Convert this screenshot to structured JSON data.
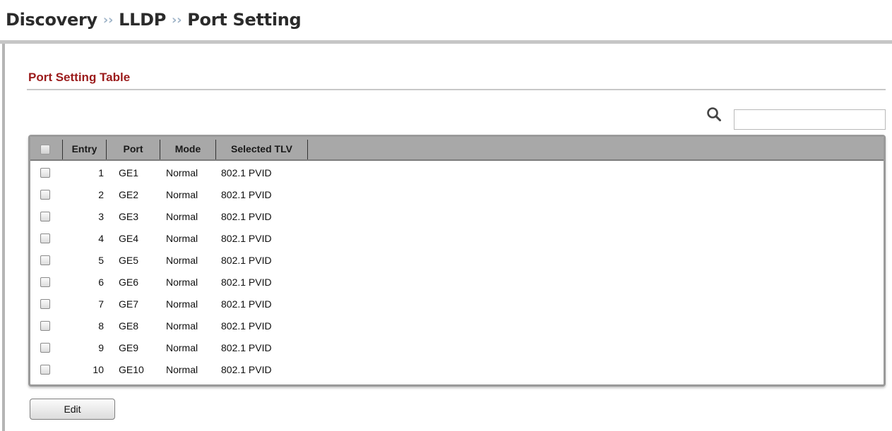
{
  "breadcrumb": {
    "items": [
      "Discovery",
      "LLDP",
      "Port Setting"
    ],
    "separator": "››"
  },
  "section": {
    "title": "Port Setting Table"
  },
  "search": {
    "icon": "search-icon",
    "value": ""
  },
  "table": {
    "columns": [
      "Entry",
      "Port",
      "Mode",
      "Selected TLV"
    ],
    "rows": [
      {
        "entry": "1",
        "port": "GE1",
        "mode": "Normal",
        "tlv": "802.1 PVID"
      },
      {
        "entry": "2",
        "port": "GE2",
        "mode": "Normal",
        "tlv": "802.1 PVID"
      },
      {
        "entry": "3",
        "port": "GE3",
        "mode": "Normal",
        "tlv": "802.1 PVID"
      },
      {
        "entry": "4",
        "port": "GE4",
        "mode": "Normal",
        "tlv": "802.1 PVID"
      },
      {
        "entry": "5",
        "port": "GE5",
        "mode": "Normal",
        "tlv": "802.1 PVID"
      },
      {
        "entry": "6",
        "port": "GE6",
        "mode": "Normal",
        "tlv": "802.1 PVID"
      },
      {
        "entry": "7",
        "port": "GE7",
        "mode": "Normal",
        "tlv": "802.1 PVID"
      },
      {
        "entry": "8",
        "port": "GE8",
        "mode": "Normal",
        "tlv": "802.1 PVID"
      },
      {
        "entry": "9",
        "port": "GE9",
        "mode": "Normal",
        "tlv": "802.1 PVID"
      },
      {
        "entry": "10",
        "port": "GE10",
        "mode": "Normal",
        "tlv": "802.1 PVID"
      }
    ]
  },
  "actions": {
    "edit_label": "Edit"
  },
  "colors": {
    "section_title": "#9b1b1b",
    "header_bg": "#a8a8a8",
    "breadcrumb_separator": "#9fb4c8"
  }
}
